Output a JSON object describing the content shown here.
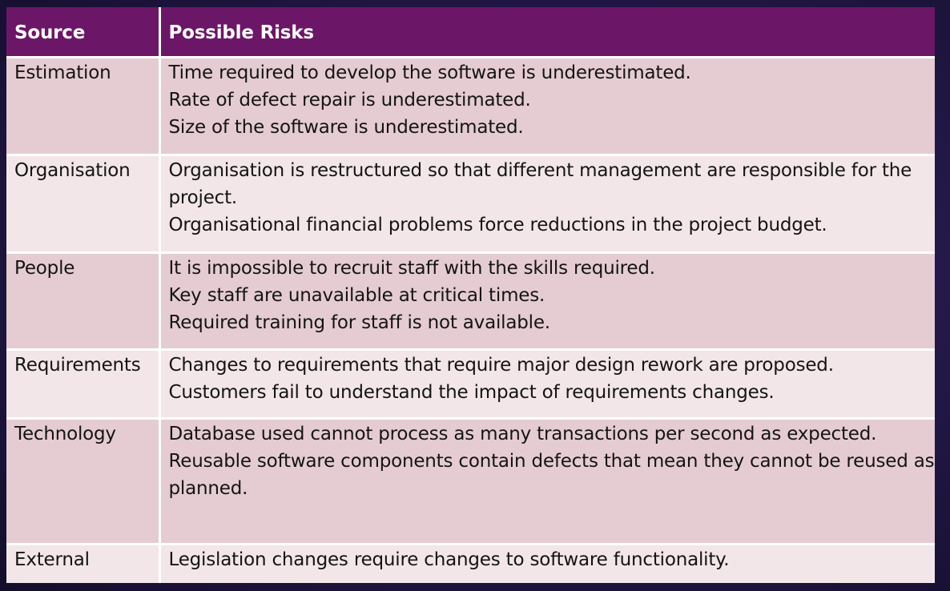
{
  "table": {
    "headers": {
      "source": "Source",
      "risks": "Possible Risks"
    },
    "rows": [
      {
        "source": "Estimation",
        "risks": [
          "Time required to develop the software is underestimated.",
          "Rate of defect repair is underestimated.",
          "Size of the software is underestimated."
        ]
      },
      {
        "source": "Organisation",
        "risks": [
          "Organisation is restructured so that different management are responsible for the project.",
          "Organisational financial problems force reductions in the project budget."
        ]
      },
      {
        "source": "People",
        "risks": [
          "It is impossible to recruit staff with the skills required.",
          "Key staff are unavailable at critical times.",
          "Required training for staff is not available."
        ]
      },
      {
        "source": "Requirements",
        "risks": [
          "Changes to requirements that require major design rework are proposed.",
          "Customers fail to understand the impact of requirements changes."
        ]
      },
      {
        "source": "Technology",
        "risks": [
          "Database used cannot process as many transactions per second as expected.",
          "Reusable software components contain defects that mean they cannot be reused as planned."
        ]
      },
      {
        "source": "External",
        "risks": [
          "Legislation changes require changes to software functionality."
        ]
      }
    ]
  },
  "colors": {
    "header_bg": "#6c1668",
    "row_dark": "#e5ccd2",
    "row_light": "#f2e6e8",
    "background": "#24194a"
  }
}
